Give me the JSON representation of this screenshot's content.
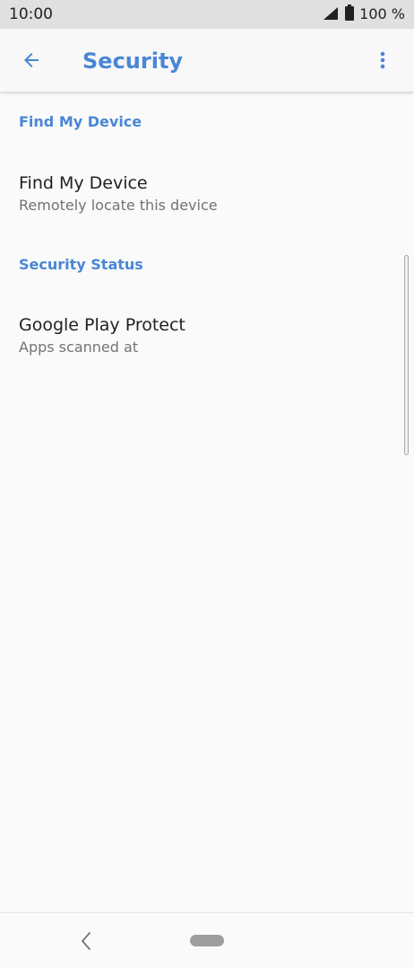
{
  "status_bar": {
    "time": "10:00",
    "battery": "100 %",
    "icons": [
      "signal-icon",
      "battery-icon"
    ]
  },
  "app_bar": {
    "title": "Security",
    "icons": [
      "back-arrow-icon",
      "more-vert-icon"
    ]
  },
  "sections": [
    {
      "header": "Find My Device",
      "items": [
        {
          "title": "Find My Device",
          "summary": "Remotely locate this device"
        }
      ]
    },
    {
      "header": "Security Status",
      "items": [
        {
          "title": "Google Play Protect",
          "summary": "Apps scanned at"
        }
      ]
    }
  ],
  "nav_bar": {
    "icons": [
      "nav-back-icon",
      "home-pill-icon"
    ]
  },
  "colors": {
    "accent": "#4a86d6",
    "status_bar": "#e0e0e0",
    "background": "#fafafa"
  }
}
